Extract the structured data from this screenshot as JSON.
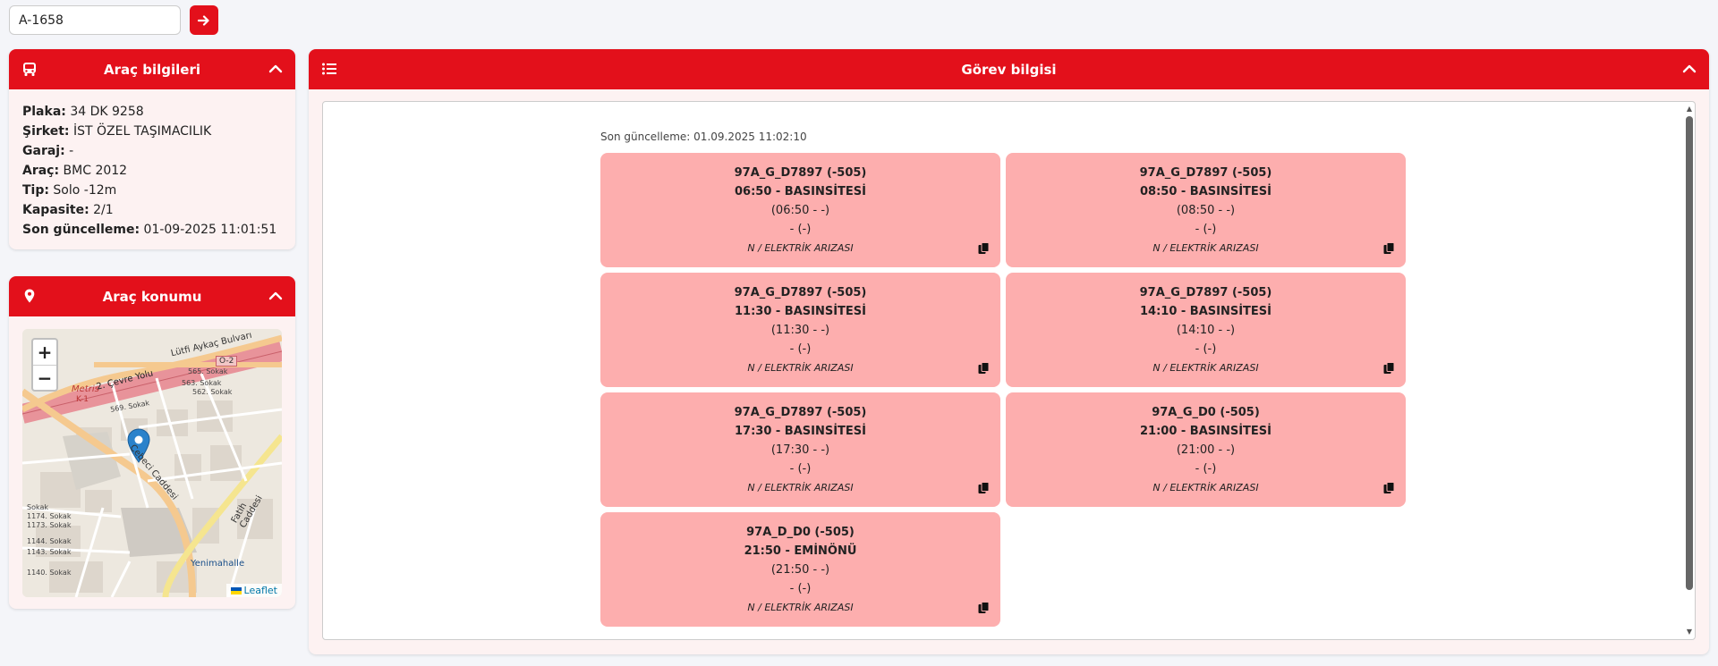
{
  "search": {
    "value": "A-1658"
  },
  "vehicle_panel": {
    "title": "Araç bilgileri",
    "rows": [
      {
        "label": "Plaka:",
        "value": "34 DK 9258"
      },
      {
        "label": "Şirket:",
        "value": "İST ÖZEL TAŞIMACILIK"
      },
      {
        "label": "Garaj:",
        "value": "-"
      },
      {
        "label": "Araç:",
        "value": "BMC 2012"
      },
      {
        "label": "Tip:",
        "value": "Solo -12m"
      },
      {
        "label": "Kapasite:",
        "value": "2/1"
      },
      {
        "label": "Son güncelleme:",
        "value": "01-09-2025 11:01:51"
      }
    ]
  },
  "location_panel": {
    "title": "Araç konumu",
    "zoom_in": "+",
    "zoom_out": "−",
    "attribution": "Leaflet",
    "map_labels": [
      "Lütfi Aykaç Bulvarı",
      "O-2",
      "2. Çevre Yolu",
      "Metris",
      "K-1",
      "Cebeci Caddesi",
      "Fatih Caddesi",
      "Yenimahalle",
      "565. Sokak",
      "563. Sokak",
      "562. Sokak",
      "569. Sokak",
      "1174. Sokak",
      "1173. Sokak",
      "1144. Sokak",
      "1143. Sokak",
      "1140. Sokak",
      "Sokak"
    ]
  },
  "task_panel": {
    "title": "Görev bilgisi",
    "last_update": "Son güncelleme: 01.09.2025 11:02:10",
    "cards": [
      {
        "code": "97A_G_D7897 (-505)",
        "time_dest": "06:50 - BASINSİTESİ",
        "range": "(06:50 - -)",
        "extra": "- (-)",
        "status": "N / ELEKTRİK ARIZASI"
      },
      {
        "code": "97A_G_D7897 (-505)",
        "time_dest": "08:50 - BASINSİTESİ",
        "range": "(08:50 - -)",
        "extra": "- (-)",
        "status": "N / ELEKTRİK ARIZASI"
      },
      {
        "code": "97A_G_D7897 (-505)",
        "time_dest": "11:30 - BASINSİTESİ",
        "range": "(11:30 - -)",
        "extra": "- (-)",
        "status": "N / ELEKTRİK ARIZASI"
      },
      {
        "code": "97A_G_D7897 (-505)",
        "time_dest": "14:10 - BASINSİTESİ",
        "range": "(14:10 - -)",
        "extra": "- (-)",
        "status": "N / ELEKTRİK ARIZASI"
      },
      {
        "code": "97A_G_D7897 (-505)",
        "time_dest": "17:30 - BASINSİTESİ",
        "range": "(17:30 - -)",
        "extra": "- (-)",
        "status": "N / ELEKTRİK ARIZASI"
      },
      {
        "code": "97A_G_D0 (-505)",
        "time_dest": "21:00 - BASINSİTESİ",
        "range": "(21:00 - -)",
        "extra": "- (-)",
        "status": "N / ELEKTRİK ARIZASI"
      },
      {
        "code": "97A_D_D0 (-505)",
        "time_dest": "21:50 - EMİNÖNÜ",
        "range": "(21:50 - -)",
        "extra": "- (-)",
        "status": "N / ELEKTRİK ARIZASI"
      }
    ]
  },
  "colors": {
    "accent": "#e3101b",
    "card": "#fdaeae",
    "panel_bg": "#fdf2f2"
  }
}
